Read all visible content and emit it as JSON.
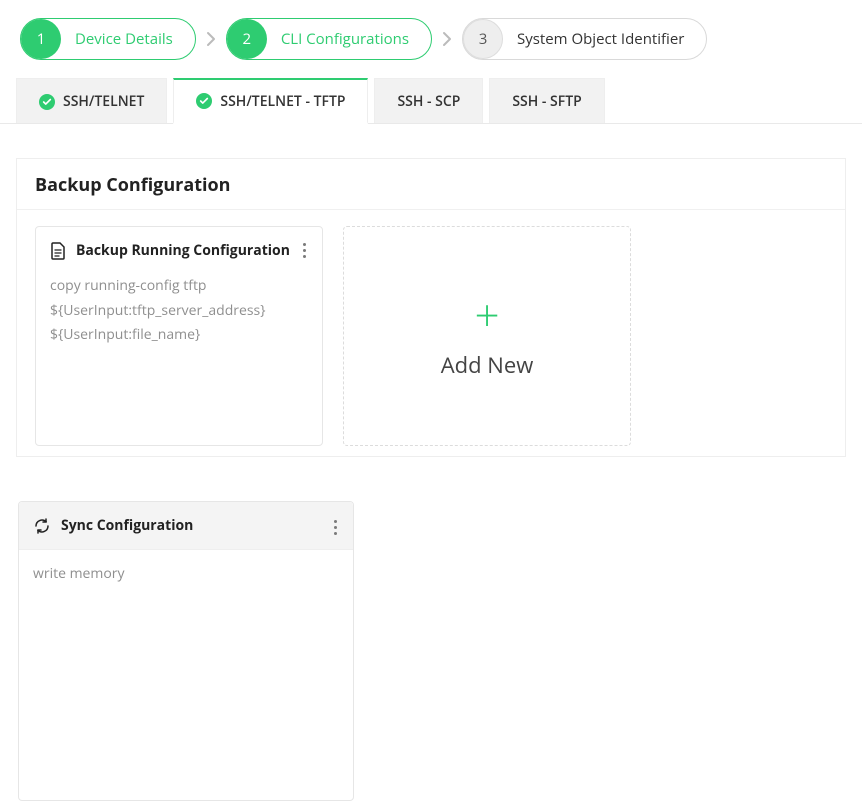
{
  "accent": "#2ecc71",
  "wizard": {
    "steps": [
      {
        "num": "1",
        "label": "Device Details",
        "state": "done"
      },
      {
        "num": "2",
        "label": "CLI Configurations",
        "state": "done"
      },
      {
        "num": "3",
        "label": "System Object Identifier",
        "state": "pending"
      }
    ]
  },
  "tabs": [
    {
      "label": "SSH/TELNET",
      "checked": true,
      "active": false
    },
    {
      "label": "SSH/TELNET - TFTP",
      "checked": true,
      "active": true
    },
    {
      "label": "SSH - SCP",
      "checked": false,
      "active": false
    },
    {
      "label": "SSH - SFTP",
      "checked": false,
      "active": false
    }
  ],
  "panel": {
    "title": "Backup Configuration",
    "add_label": "Add New",
    "backup_card": {
      "title": "Backup Running Configuration",
      "lines": [
        "copy running-config tftp",
        "${UserInput:tftp_server_address}",
        "${UserInput:file_name}"
      ]
    },
    "sync_card": {
      "title": "Sync Configuration",
      "lines": [
        "write memory"
      ]
    }
  }
}
